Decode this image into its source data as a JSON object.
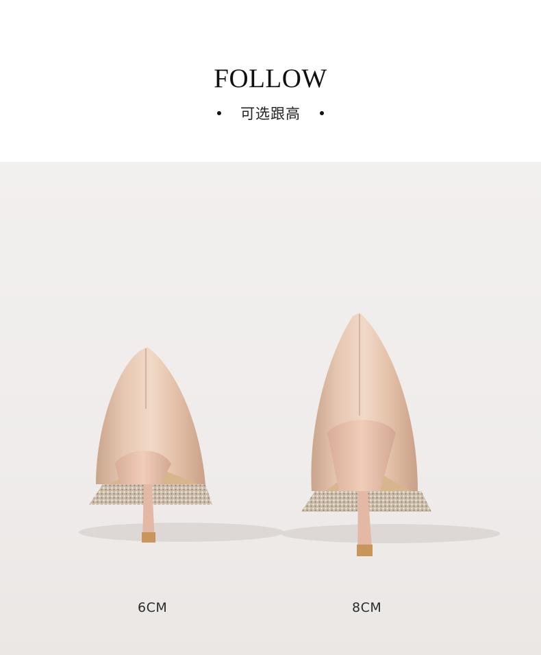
{
  "header": {
    "title": "FOLLOW",
    "subtitle": "可选跟高"
  },
  "photo": {
    "description_colors": {
      "background": "#efeceb",
      "shoe": "#e2bfa6",
      "sole": "#d9b98f"
    },
    "options": [
      {
        "label": "6CM"
      },
      {
        "label": "8CM"
      }
    ]
  }
}
